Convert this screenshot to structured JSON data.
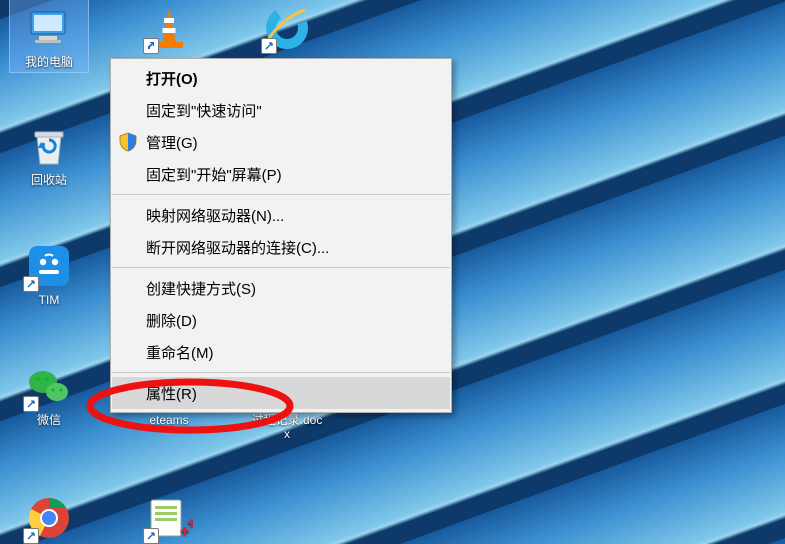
{
  "desktop_icons": {
    "my_computer": "我的电脑",
    "recycle_bin": "回收站",
    "tim": "TIM",
    "wechat": "微信",
    "eteams": "eteams",
    "process_doc": "过程记录.docx",
    "vlc": "",
    "ie": ""
  },
  "context_menu": {
    "open": "打开(O)",
    "pin_quick_access": "固定到\"快速访问\"",
    "manage": "管理(G)",
    "pin_start": "固定到\"开始\"屏幕(P)",
    "map_network_drive": "映射网络驱动器(N)...",
    "disconnect_network_drive": "断开网络驱动器的连接(C)...",
    "create_shortcut": "创建快捷方式(S)",
    "delete": "删除(D)",
    "rename": "重命名(M)",
    "properties": "属性(R)"
  }
}
